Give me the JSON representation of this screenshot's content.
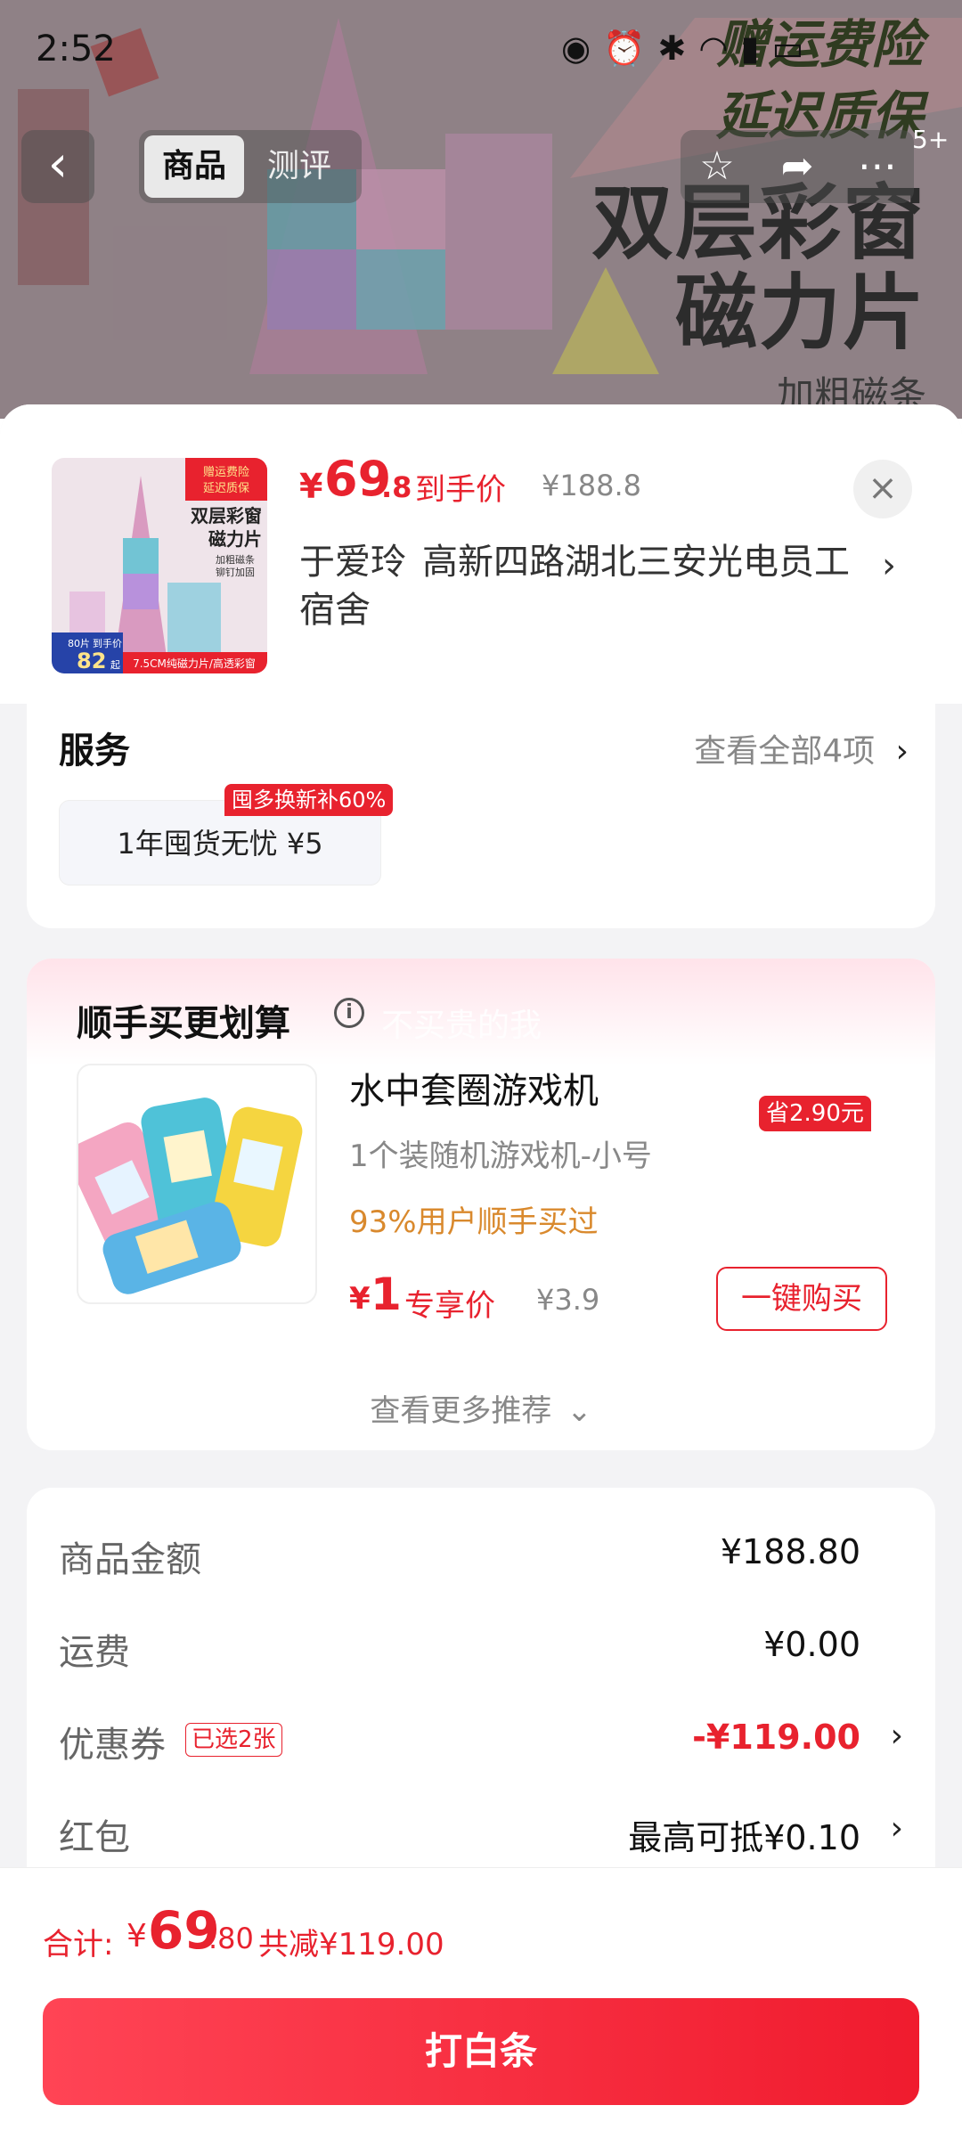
{
  "status_bar": {
    "time": "2:52",
    "icons": [
      "eye-icon",
      "alarm-icon",
      "bluetooth-icon",
      "wifi-icon",
      "signal-icon",
      "battery-icon"
    ]
  },
  "hero": {
    "badge_line1": "赠运费险",
    "badge_line2": "延迟质保",
    "headline_line1": "双层彩窗",
    "headline_line2": "磁力片",
    "sub": "加粗磁条",
    "notification_count": "5+"
  },
  "nav": {
    "back_icon": "chevron-left-icon",
    "tab_goods": "商品",
    "tab_review": "测评",
    "actions": [
      "star-icon",
      "share-icon",
      "more-icon"
    ]
  },
  "summary": {
    "price_currency": "¥",
    "price_int": "69",
    "price_dec": ".8",
    "price_label": "到手价",
    "original_price": "¥188.8",
    "recipient": "于爱玲",
    "address": "高新四路湖北三安光电员工宿舍",
    "thumb_texts": {
      "badge1": "赠运费险",
      "badge2": "延迟质保",
      "title1": "双层彩窗",
      "title2": "磁力片",
      "small1": "加粗磁条",
      "small2": "铆钉加固",
      "pieces": "80片",
      "price_label": "到手价",
      "price": "82",
      "unit": "起",
      "footer": "7.5CM纯磁力片/高透彩窗"
    }
  },
  "service": {
    "title": "服务",
    "view_all": "查看全部4项",
    "item_label": "1年囤货无忧  ¥5",
    "item_tag": "囤多换新补60%"
  },
  "addon": {
    "title": "顺手买更划算",
    "watermark": "不买贵的我",
    "product_name": "水中套圈游戏机",
    "spec": "1个装随机游戏机-小号",
    "hint": "93%用户顺手买过",
    "price_currency": "¥",
    "price_int": "1",
    "price_label": "专享价",
    "original_price": "¥3.9",
    "save_tag": "省2.90元",
    "buy_button": "一键购买",
    "more": "查看更多推荐"
  },
  "fees": {
    "goods_label": "商品金额",
    "goods_value": "¥188.80",
    "shipping_label": "运费",
    "shipping_value": "¥0.00",
    "coupon_label": "优惠券",
    "coupon_tag": "已选2张",
    "coupon_value": "-¥119.00",
    "redpacket_label": "红包",
    "redpacket_value": "最高可抵¥0.10"
  },
  "bottom": {
    "total_label": "合计:",
    "total_currency": "¥",
    "total_int": "69",
    "total_dec": ".80",
    "total_saved": "共减¥119.00",
    "pay_button": "打白条"
  },
  "colors": {
    "accent_red": "#e8222e",
    "hint_orange": "#d9892d"
  }
}
